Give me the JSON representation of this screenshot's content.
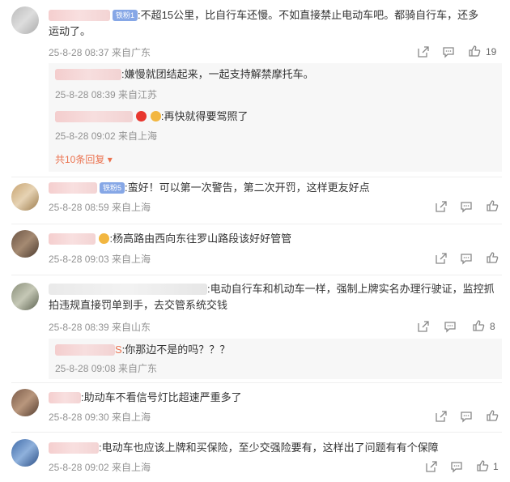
{
  "comments": [
    {
      "badge": "铁粉1",
      "text": ":不超15公里，比自行车还慢。不如直接禁止电动车吧。都骑自行车，还多",
      "text2": "运动了。",
      "meta": "25-8-28 08:37 来自广东",
      "likes": "19",
      "replies": [
        {
          "text": ":嫌慢就团结起来，一起支持解禁摩托车。",
          "meta": "25-8-28 08:39 来自江苏"
        },
        {
          "text": ":再快就得要驾照了",
          "meta": "25-8-28 09:02 来自上海"
        }
      ],
      "more_replies": "共10条回复"
    },
    {
      "badge": "铁粉5",
      "text": ":蛮好！可以第一次警告，第二次开罚，这样更友好点",
      "meta": "25-8-28 08:59 来自上海"
    },
    {
      "text": ":杨高路由西向东往罗山路段该好好管管",
      "meta": "25-8-28 09:03 来自上海"
    },
    {
      "text": ":电动自行车和机动车一样，强制上牌实名办理行驶证，监控抓",
      "text2": "拍违规直接罚单到手，去交管系统交钱",
      "meta": "25-8-28 08:39 来自山东",
      "likes": "8",
      "replies": [
        {
          "prefix": "S",
          "text": ":你那边不是的吗？？？",
          "meta": "25-8-28 09:08 来自广东"
        }
      ]
    },
    {
      "text": ":助动车不看信号灯比超速严重多了",
      "meta": "25-8-28 09:30 来自上海"
    },
    {
      "text": ":电动车也应该上牌和买保险，至少交强险要有，这样出了问题有有个保障",
      "meta": "25-8-28 09:02 来自上海",
      "likes": "1"
    }
  ],
  "icons": {
    "share": "share-icon",
    "comment": "comment-icon",
    "like": "like-icon"
  },
  "colors": {
    "link": "#eb7350",
    "meta": "#939393",
    "badge": "#86a7e6"
  }
}
